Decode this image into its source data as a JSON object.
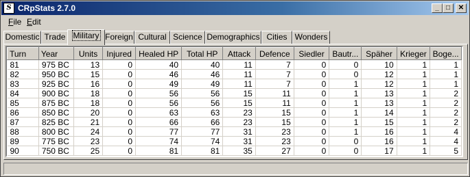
{
  "window": {
    "title": "CRpStats 2.7.0",
    "icon": "app-s-icon"
  },
  "controls": {
    "minimize": "_",
    "maximize": "□",
    "close": "✕"
  },
  "menu": [
    {
      "label": "File",
      "mnemonic": "F"
    },
    {
      "label": "Edit",
      "mnemonic": "E"
    }
  ],
  "tabs": [
    "Domestic",
    "Trade",
    "Military",
    "Foreign",
    "Cultural",
    "Science",
    "Demographics",
    "Cities",
    "Wonders"
  ],
  "active_tab": "Military",
  "table": {
    "columns": [
      "Turn",
      "Year",
      "Units",
      "Injured",
      "Healed HP",
      "Total HP",
      "Attack",
      "Defence",
      "Siedler",
      "Bautr...",
      "Späher",
      "Krieger",
      "Boge..."
    ],
    "rows": [
      [
        "81",
        "975 BC",
        "13",
        "0",
        "40",
        "40",
        "11",
        "7",
        "0",
        "0",
        "10",
        "1",
        "1"
      ],
      [
        "82",
        "950 BC",
        "15",
        "0",
        "46",
        "46",
        "11",
        "7",
        "0",
        "0",
        "12",
        "1",
        "1"
      ],
      [
        "83",
        "925 BC",
        "16",
        "0",
        "49",
        "49",
        "11",
        "7",
        "0",
        "1",
        "12",
        "1",
        "1"
      ],
      [
        "84",
        "900 BC",
        "18",
        "0",
        "56",
        "56",
        "15",
        "11",
        "0",
        "1",
        "13",
        "1",
        "2"
      ],
      [
        "85",
        "875 BC",
        "18",
        "0",
        "56",
        "56",
        "15",
        "11",
        "0",
        "1",
        "13",
        "1",
        "2"
      ],
      [
        "86",
        "850 BC",
        "20",
        "0",
        "63",
        "63",
        "23",
        "15",
        "0",
        "1",
        "14",
        "1",
        "2"
      ],
      [
        "87",
        "825 BC",
        "21",
        "0",
        "66",
        "66",
        "23",
        "15",
        "0",
        "1",
        "15",
        "1",
        "2"
      ],
      [
        "88",
        "800 BC",
        "24",
        "0",
        "77",
        "77",
        "31",
        "23",
        "0",
        "1",
        "16",
        "1",
        "4"
      ],
      [
        "89",
        "775 BC",
        "23",
        "0",
        "74",
        "74",
        "31",
        "23",
        "0",
        "0",
        "16",
        "1",
        "4"
      ],
      [
        "90",
        "750 BC",
        "25",
        "0",
        "81",
        "81",
        "35",
        "27",
        "0",
        "0",
        "17",
        "1",
        "5"
      ]
    ]
  },
  "status": ""
}
